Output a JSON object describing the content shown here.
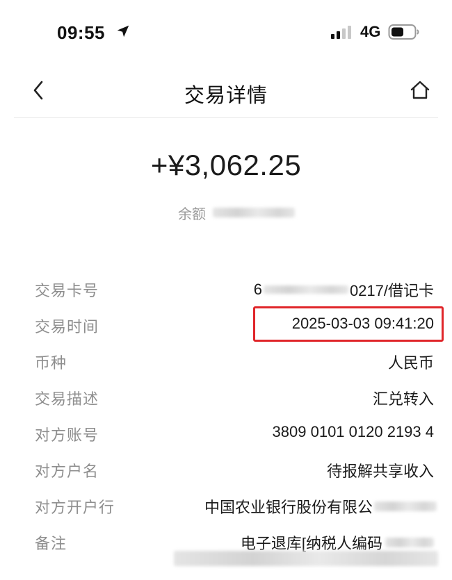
{
  "status_bar": {
    "time": "09:55",
    "network": "4G",
    "icons": [
      "location-arrow-icon",
      "signal-icon",
      "battery-icon"
    ]
  },
  "nav": {
    "title": "交易详情",
    "icons": [
      "back-chevron-icon",
      "home-icon"
    ]
  },
  "transaction": {
    "amount": "+¥3,062.25",
    "balance_label": "余额"
  },
  "details": [
    {
      "label": "交易卡号",
      "value_prefix": "6",
      "value": "0217/借记卡"
    },
    {
      "label": "交易时间",
      "value": "2025-03-03 09:41:20"
    },
    {
      "label": "币种",
      "value": "人民币"
    },
    {
      "label": "交易描述",
      "value": "汇兑转入"
    },
    {
      "label": "对方账号",
      "value": "3809 0101 0120 2193 4"
    },
    {
      "label": "对方户名",
      "value": "待报解共享收入"
    },
    {
      "label": "对方开户行",
      "value": "中国农业银行股份有限公"
    },
    {
      "label": "备注",
      "value": "电子退库[纳税人编码"
    }
  ],
  "colors": {
    "highlight": "#e0262a",
    "label": "#8e8e8e",
    "text": "#1b1b1b"
  }
}
